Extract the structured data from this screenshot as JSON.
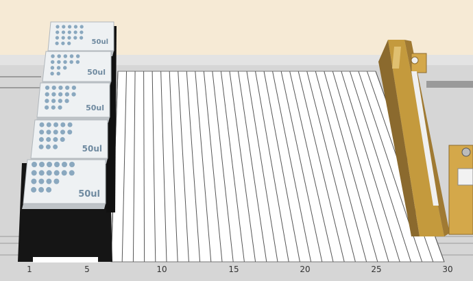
{
  "deck": {
    "tip_racks": [
      {
        "volume_label": "50ul",
        "rows": [
          5,
          5,
          5,
          3
        ],
        "row_lengths": [
          5,
          5,
          5,
          3
        ]
      },
      {
        "volume_label": "50ul",
        "rows": [
          5,
          5,
          3,
          2
        ]
      },
      {
        "volume_label": "50ul",
        "rows": [
          5,
          5,
          4,
          3
        ]
      },
      {
        "volume_label": "50ul",
        "rows": [
          5,
          5,
          4,
          3
        ]
      },
      {
        "volume_label": "50ul",
        "rows": [
          6,
          6,
          4,
          3
        ]
      }
    ],
    "axis_ticks": [
      "1",
      "5",
      "10",
      "15",
      "20",
      "25",
      "30"
    ],
    "grid_columns": 30,
    "colors": {
      "background": "#f6ead5",
      "deck": "#d9d9d9",
      "carrier": "#151515",
      "gripper": "#8b6a2e",
      "tip": "#8aa8bf"
    },
    "icons": {
      "gripper": "gripper-arm-icon",
      "screw": "screw-icon"
    }
  }
}
